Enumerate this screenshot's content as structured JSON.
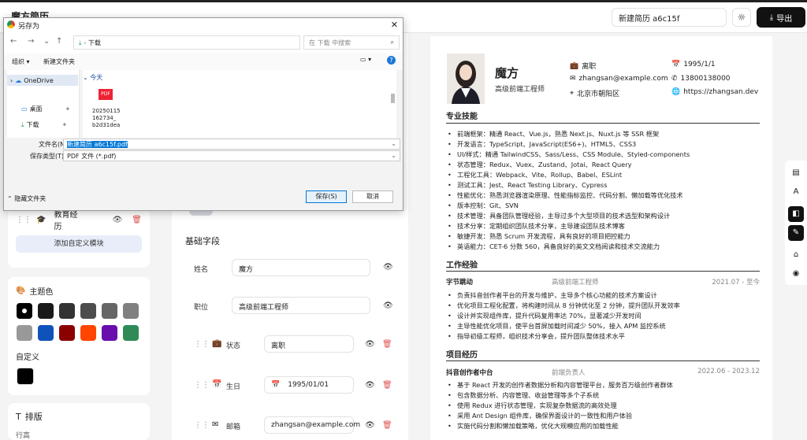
{
  "app": {
    "title": "魔方简历",
    "doc_name": "新建简历 a6c15f",
    "export_label": "导出"
  },
  "sidebar": {
    "modules": [
      {
        "label": "教育经历"
      }
    ],
    "add_module_label": "添加自定义模块",
    "theme_title": "主题色",
    "custom_label": "自定义",
    "swatches": [
      "#000000",
      "#1a1a1a",
      "#333333",
      "#4d4d4d",
      "#666666",
      "#808080",
      "#999999",
      "#0f52ba",
      "#8b0000",
      "#ff4500",
      "#6a0dad",
      "#2e8b57"
    ],
    "layout_title": "排版",
    "line_height_label": "行高"
  },
  "editor": {
    "section_title": "基础字段",
    "fields": [
      {
        "label": "姓名",
        "value": "魔方"
      },
      {
        "label": "职位",
        "value": "高级前端工程师"
      },
      {
        "label": "状态",
        "value": "离职"
      },
      {
        "label": "生日",
        "value": "1995/01/01"
      },
      {
        "label": "邮箱",
        "value": "zhangsan@example.com"
      }
    ]
  },
  "resume": {
    "name": "魔方",
    "title": "高级前端工程师",
    "status": "离职",
    "birthday": "1995/1/1",
    "email": "zhangsan@example.com",
    "phone": "13800138000",
    "location": "北京市朝阳区",
    "website": "https://zhangsan.dev",
    "skills_title": "专业技能",
    "skills": [
      "前端框架：精通 React、Vue.js，熟悉 Next.js、Nuxt.js 等 SSR 框架",
      "开发语言：TypeScript、JavaScript(ES6+)、HTML5、CSS3",
      "UI/样式：精通 TailwindCSS、Sass/Less、CSS Module、Styled-components",
      "状态管理：Redux、Vuex、Zustand、Jotai、React Query",
      "工程化工具：Webpack、Vite、Rollup、Babel、ESLint",
      "测试工具：Jest、React Testing Library、Cypress",
      "性能优化：熟悉浏览器渲染原理、性能指标监控、代码分割、懒加载等优化技术",
      "版本控制：Git、SVN",
      "技术管理：具备团队管理经验，主导过多个大型项目的技术选型和架构设计",
      "技术分享：定期组织团队技术分享，主导建设团队技术博客",
      "敏捷开发：熟悉 Scrum 开发流程，具有良好的项目把控能力",
      "英语能力：CET-6 分数 560，具备良好的英文文档阅读和技术交流能力"
    ],
    "work_title": "工作经验",
    "work": {
      "company": "字节跳动",
      "role": "高级前端工程师",
      "date": "2021.07 - 至今",
      "items": [
        "负责抖音创作者平台的开发与维护，主导多个核心功能的技术方案设计",
        "优化项目工程化配置，将构建时间从 8 分钟优化至 2 分钟，提升团队开发效率",
        "设计并实现组件库，提升代码复用率达 70%，显著减少开发时间",
        "主导性能优化项目，使平台首屏加载时间减少 50%，接入 APM 监控系统",
        "指导初级工程师，组织技术分享会，提升团队整体技术水平"
      ]
    },
    "project_title": "项目经历",
    "project": {
      "name": "抖音创作者中台",
      "role": "前端负责人",
      "date": "2022.06 - 2023.12",
      "items": [
        "基于 React 开发的创作者数据分析和内容管理平台，服务百万级创作者群体",
        "包含数据分析、内容管理、收益管理等多个子系统",
        "使用 Redux 进行状态管理，实现复杂数据流的高效处理",
        "采用 Ant Design 组件库，确保界面设计的一致性和用户体验",
        "实施代码分割和懒加载策略，优化大规模应用的加载性能"
      ]
    }
  },
  "dialog": {
    "title": "另存为",
    "path": "下载",
    "search_placeholder": "在 下载 中搜索",
    "organize_label": "组织",
    "new_folder_label": "新建文件夹",
    "tree": [
      "OneDrive",
      "桌面",
      "下载"
    ],
    "group_label": "今天",
    "file_badge": "PDF",
    "file_name": "20250115 162734_ b2d31dea",
    "filename_label": "文件名(N):",
    "filename_value": "新建简历 a6c15f.pdf",
    "type_label": "保存类型(T):",
    "type_value": "PDF 文件 (*.pdf)",
    "hide_folders_label": "隐藏文件夹",
    "save_label": "保存(S)",
    "cancel_label": "取消"
  },
  "colors": {
    "accent": "#0078d7",
    "danger": "#e05252",
    "dark": "#111111"
  }
}
